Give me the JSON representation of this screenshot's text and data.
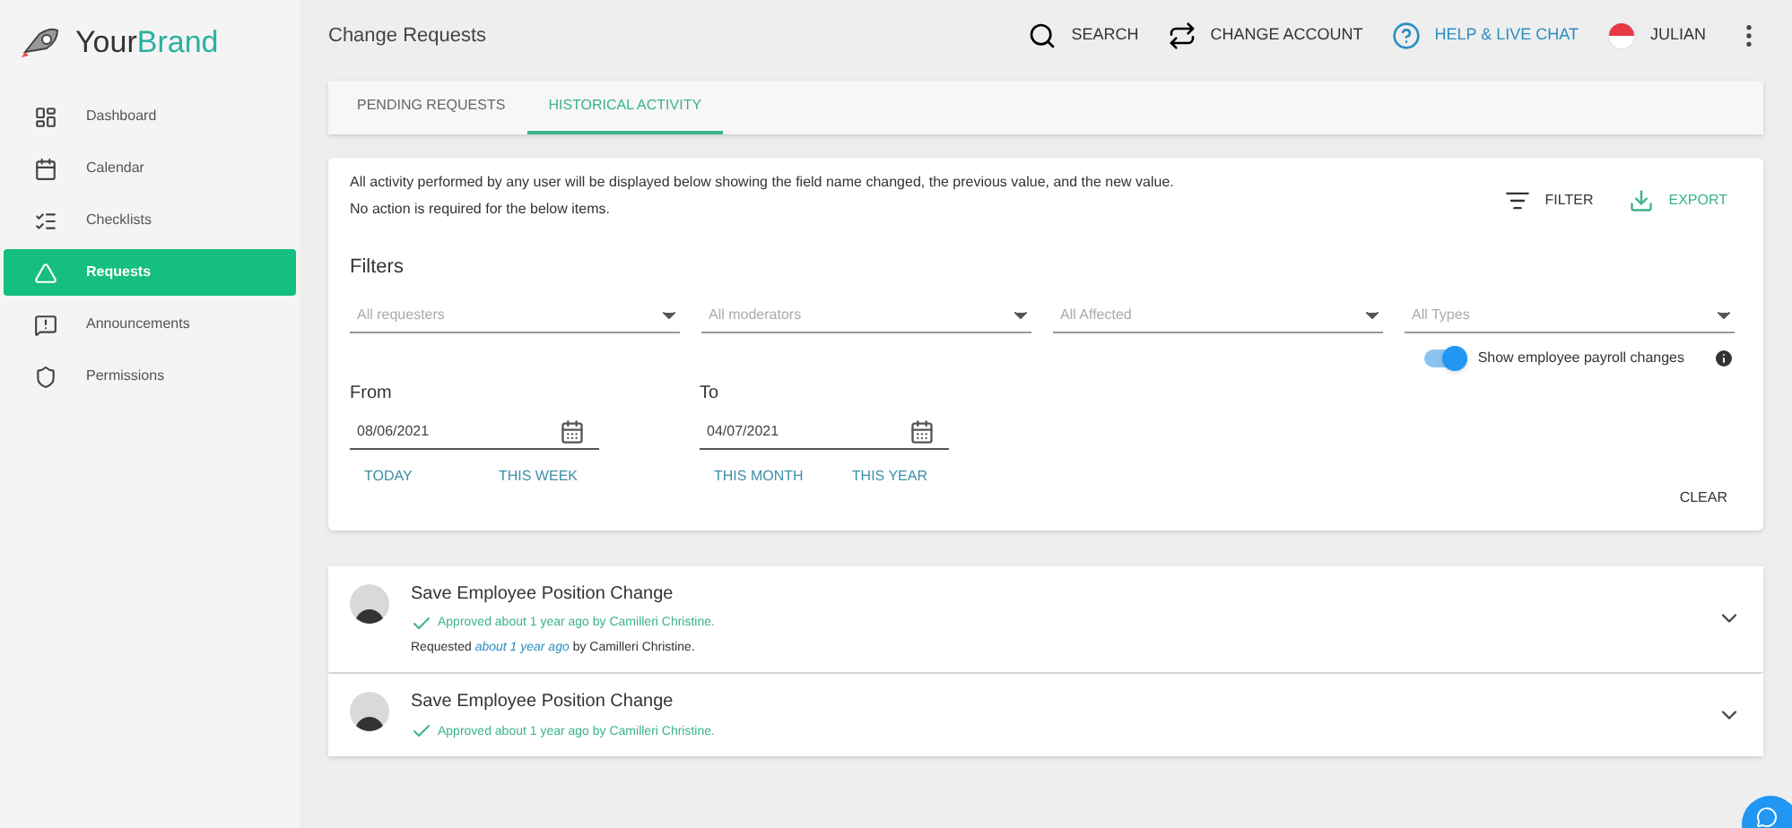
{
  "brand": {
    "prefix": "Your",
    "suffix": "Brand"
  },
  "sidebar": {
    "items": [
      {
        "label": "Dashboard",
        "kind": "dashboard",
        "selected": false
      },
      {
        "label": "Calendar",
        "kind": "calendar",
        "selected": false
      },
      {
        "label": "Checklists",
        "kind": "checklist",
        "selected": false
      },
      {
        "label": "Requests",
        "kind": "triangle",
        "selected": true
      },
      {
        "label": "Announcements",
        "kind": "announce",
        "selected": false
      },
      {
        "label": "Permissions",
        "kind": "shield",
        "selected": false
      }
    ]
  },
  "header": {
    "title": "Change Requests",
    "actions": [
      {
        "label": "SEARCH",
        "kind": "search"
      },
      {
        "label": "CHANGE ACCOUNT",
        "kind": "swap"
      },
      {
        "label": "HELP & LIVE CHAT",
        "kind": "help"
      },
      {
        "label": "JULIAN",
        "kind": "user"
      }
    ]
  },
  "tabs": [
    {
      "label": "PENDING REQUESTS",
      "selected": false
    },
    {
      "label": "HISTORICAL ACTIVITY",
      "selected": true
    }
  ],
  "intro": [
    "All activity performed by any user will be displayed below showing the field name changed, the previous value, and the new value.",
    "No action is required for the below items."
  ],
  "tools": [
    {
      "label": "FILTER",
      "kind": "filter"
    },
    {
      "label": "EXPORT",
      "kind": "export"
    }
  ],
  "filters": {
    "title": "Filters",
    "selects": [
      {
        "placeholder": "All requesters"
      },
      {
        "placeholder": "All moderators"
      },
      {
        "placeholder": "All Affected"
      },
      {
        "placeholder": "All Types"
      }
    ],
    "payroll_toggle": {
      "label": "Show employee payroll changes",
      "on": true
    }
  },
  "dates": [
    {
      "label": "From",
      "value": "08/06/2021",
      "shortcuts": [
        "TODAY",
        "THIS WEEK"
      ]
    },
    {
      "label": "To",
      "value": "04/07/2021",
      "shortcuts": [
        "THIS MONTH",
        "THIS YEAR"
      ]
    }
  ],
  "clear_button": "CLEAR",
  "requests": [
    {
      "title": "Save Employee Position Change",
      "approved": "Approved about 1 year ago by Camilleri Christine.",
      "requested": {
        "prefix": "Requested",
        "link": "about 1 year ago",
        "suffix": "by Camilleri Christine."
      }
    },
    {
      "title": "Save Employee Position Change",
      "approved": "Approved about 1 year ago by Camilleri Christine."
    }
  ]
}
